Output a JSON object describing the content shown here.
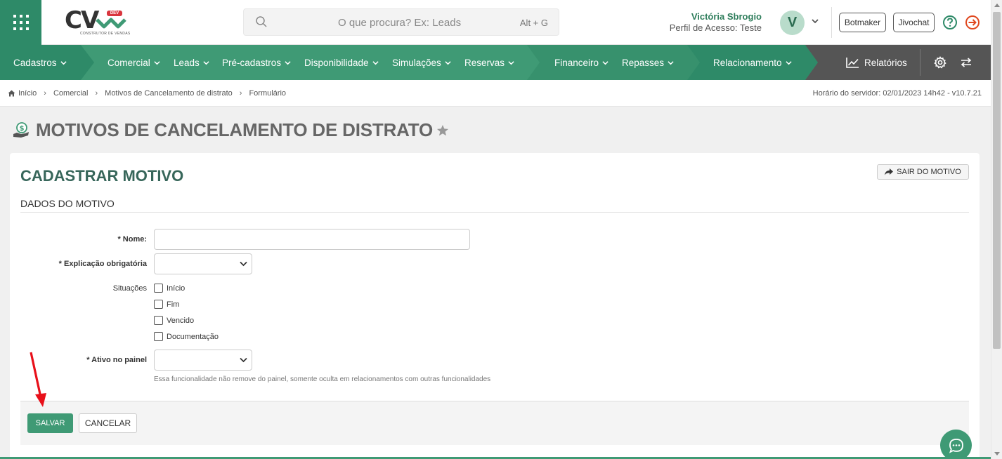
{
  "header": {
    "logo": {
      "text": "CV",
      "badge": "DEV",
      "subtitle": "CONSTRUTOR DE VENDAS"
    },
    "search": {
      "placeholder": "O que procura? Ex: Leads",
      "shortcut": "Alt + G"
    },
    "user": {
      "name": "Victória Sbrogio",
      "profile": "Perfil de Acesso: Teste",
      "initial": "V"
    },
    "buttons": {
      "botmaker": "Botmaker",
      "jivochat": "Jivochat"
    },
    "icons": {
      "apps": "grid-icon",
      "help": "help-circle-icon",
      "logout": "logout-icon"
    }
  },
  "nav": {
    "items": [
      {
        "label": "Cadastros"
      },
      {
        "label": "Comercial"
      },
      {
        "label": "Leads"
      },
      {
        "label": "Pré-cadastros"
      },
      {
        "label": "Disponibilidade"
      },
      {
        "label": "Simulações"
      },
      {
        "label": "Reservas"
      },
      {
        "label": "Financeiro"
      },
      {
        "label": "Repasses"
      },
      {
        "label": "Relacionamento"
      }
    ],
    "reports": "Relatórios",
    "colors": {
      "base": "#3f9a75",
      "dark": "#2e8a68",
      "mid": "#37916d",
      "gray": "#555555"
    }
  },
  "breadcrumb": {
    "items": [
      "Início",
      "Comercial",
      "Motivos de Cancelamento de distrato",
      "Formulário"
    ],
    "server_time": "Horário do servidor: 02/01/2023 14h42 - v10.7.21"
  },
  "page": {
    "title": "MOTIVOS DE CANCELAMENTO DE DISTRATO"
  },
  "form": {
    "title": "CADASTRAR MOTIVO",
    "exit_label": "SAIR DO MOTIVO",
    "section": "DADOS DO MOTIVO",
    "fields": {
      "nome": {
        "label": "* Nome:",
        "value": ""
      },
      "explicacao": {
        "label": "* Explicação obrigatória",
        "value": ""
      },
      "situacoes": {
        "label": "Situações",
        "options": [
          "Início",
          "Fim",
          "Vencido",
          "Documentação"
        ]
      },
      "ativo": {
        "label": "* Ativo no painel",
        "value": "",
        "help": "Essa funcionalidade não remove do painel, somente oculta em relacionamentos com outras funcionalidades"
      }
    },
    "save_label": "SALVAR",
    "cancel_label": "CANCELAR"
  }
}
